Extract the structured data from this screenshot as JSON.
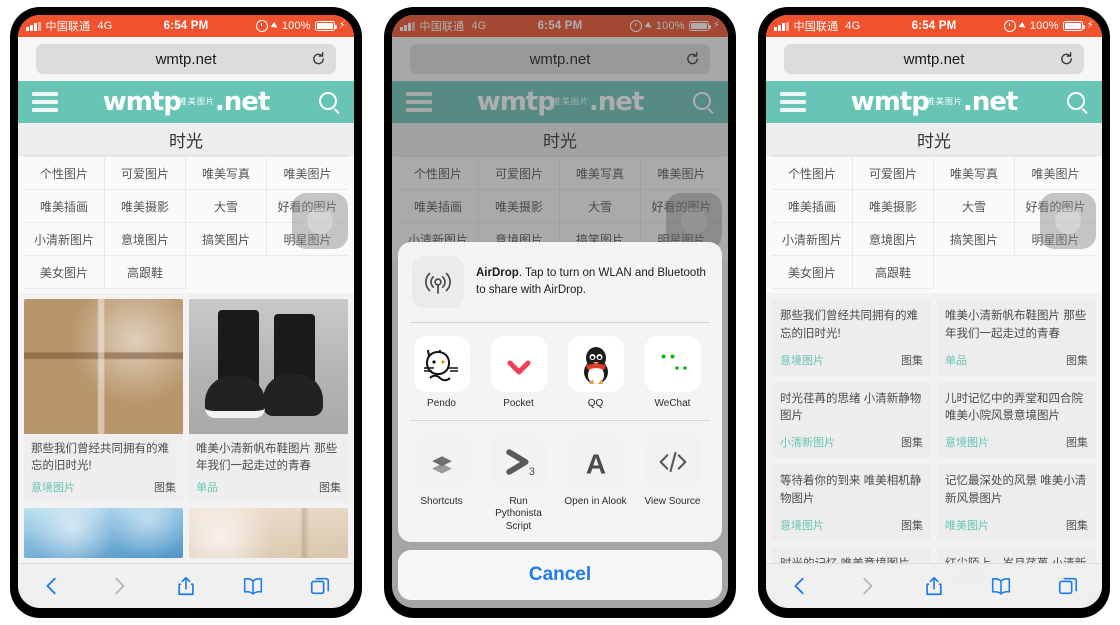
{
  "status_bar": {
    "carrier": "中国联通",
    "network": "4G",
    "time": "6:54 PM",
    "battery_percent": "100%",
    "icons": [
      "signal-bars-icon",
      "alarm-icon",
      "location-arrow-icon",
      "battery-charging-icon"
    ]
  },
  "browser": {
    "url": "wmtp.net",
    "reload_label": "reload-icon",
    "toolbar": {
      "back": "back-icon",
      "forward": "forward-icon",
      "share": "share-icon",
      "bookmarks": "bookmarks-icon",
      "tabs": "tabs-icon"
    }
  },
  "site": {
    "menu_label": "hamburger-menu-icon",
    "logo_text": "wmtp",
    "logo_suffix": ".net",
    "logo_cn": "唯美图片",
    "search_label": "search-icon",
    "page_title": "时光",
    "categories": [
      "个性图片",
      "可爱图片",
      "唯美写真",
      "唯美图片",
      "唯美插画",
      "唯美摄影",
      "大雪",
      "好看的图片",
      "小清新图片",
      "意境图片",
      "搞笑图片",
      "明星图片",
      "美女图片",
      "高跟鞋"
    ]
  },
  "cards": [
    {
      "title": "那些我们曾经共同拥有的难忘的旧时光!",
      "tag": "意境图片",
      "kind": "图集",
      "art": "art-classroom"
    },
    {
      "title": "唯美小清新帆布鞋图片 那些年我们一起走过的青春",
      "tag": "单品",
      "kind": "图集",
      "art": "art-shoes"
    },
    {
      "title": "时光荏苒的思绪 小清新静物图片",
      "tag": "小清新图片",
      "kind": "图集",
      "art": "art-winter1"
    },
    {
      "title": "儿时记忆中的弄堂和四合院 唯美小院风景意境图片",
      "tag": "意境图片",
      "kind": "图集",
      "art": "art-winter2"
    }
  ],
  "text_cards": [
    {
      "title": "那些我们曾经共同拥有的难忘的旧时光!",
      "tag": "意境图片",
      "kind": "图集"
    },
    {
      "title": "唯美小清新帆布鞋图片 那些年我们一起走过的青春",
      "tag": "单品",
      "kind": "图集"
    },
    {
      "title": "时光荏苒的思绪 小清新静物图片",
      "tag": "小清新图片",
      "kind": "图集"
    },
    {
      "title": "儿时记忆中的弄堂和四合院 唯美小院风景意境图片",
      "tag": "意境图片",
      "kind": "图集"
    },
    {
      "title": "等待着你的到来 唯美相机静物图片",
      "tag": "意境图片",
      "kind": "图集"
    },
    {
      "title": "记忆最深处的风景 唯美小清新风景图片",
      "tag": "唯美图片",
      "kind": "图集"
    },
    {
      "title": "时光的记忆 唯美意境图片",
      "tag": "",
      "kind": ""
    },
    {
      "title": "红尘陌上，岁月荏苒 小清新文艺静物",
      "tag": "",
      "kind": ""
    }
  ],
  "share_sheet": {
    "airdrop": {
      "icon": "airdrop-icon",
      "bold": "AirDrop",
      "text": ". Tap to turn on WLAN and Bluetooth to share with AirDrop."
    },
    "apps": [
      {
        "label": "Pendo",
        "icon": "pendo-cat-icon"
      },
      {
        "label": "Pocket",
        "icon": "pocket-icon"
      },
      {
        "label": "QQ",
        "icon": "qq-penguin-icon"
      },
      {
        "label": "WeChat",
        "icon": "wechat-icon"
      },
      {
        "label": "",
        "icon": "partial-app-icon"
      }
    ],
    "actions": [
      {
        "label": "Shortcuts",
        "icon": "shortcuts-icon"
      },
      {
        "label": "Run Pythonista Script",
        "icon": "pythonista-icon"
      },
      {
        "label": "Open in Alook",
        "icon": "alook-icon"
      },
      {
        "label": "View Source",
        "icon": "view-source-icon"
      },
      {
        "label": "",
        "icon": "partial-action-icon"
      }
    ],
    "cancel_label": "Cancel"
  },
  "colors": {
    "status_bar": "#f0522e",
    "site_header": "#68c5b5",
    "tag": "#68c5b5",
    "link_blue": "#1e7ce8",
    "pocket": "#ee4056",
    "wechat": "#09bb07"
  }
}
